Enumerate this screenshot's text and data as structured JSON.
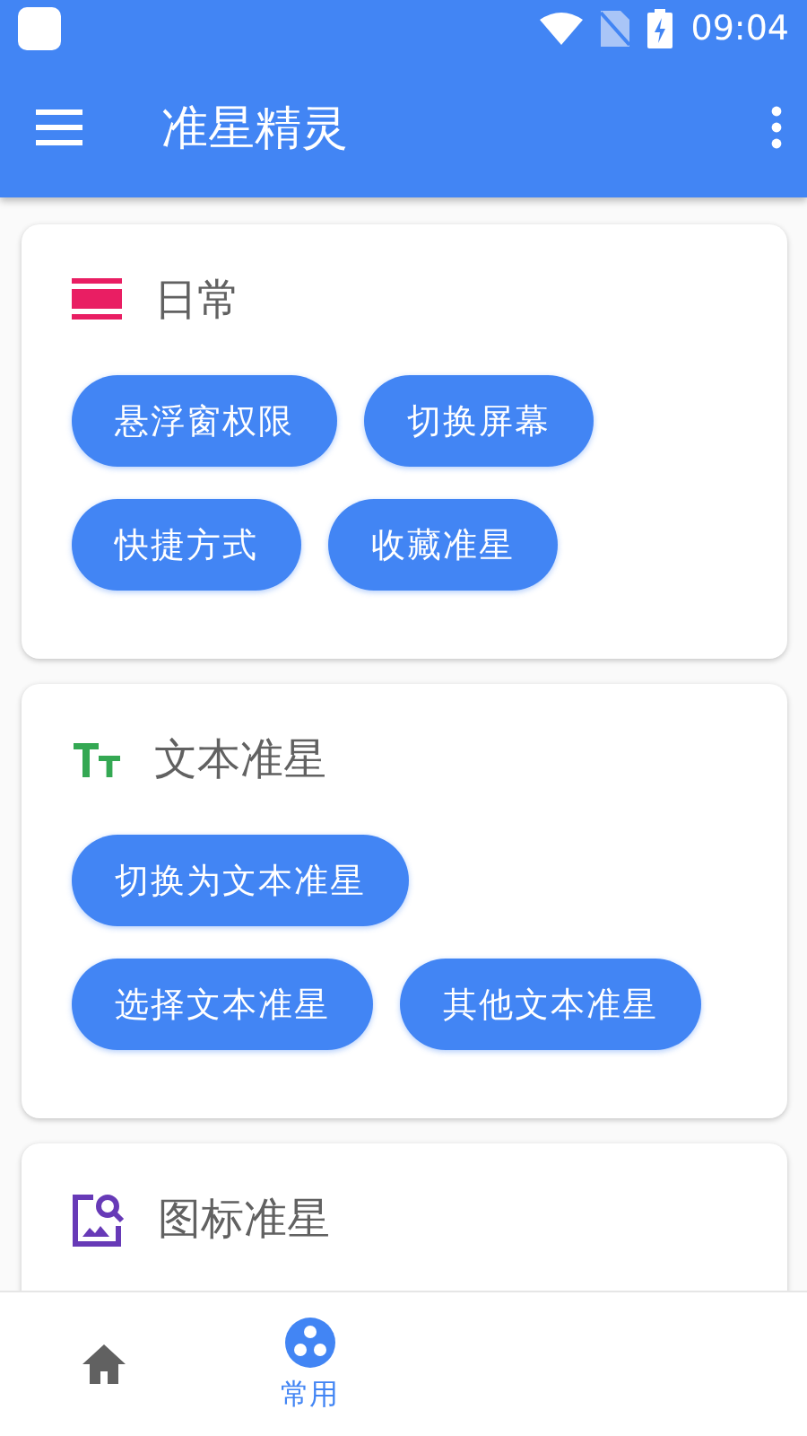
{
  "status_bar": {
    "time": "09:04"
  },
  "app_bar": {
    "title": "准星精灵"
  },
  "cards": [
    {
      "kind": "list",
      "title": "日常",
      "buttons": [
        "悬浮窗权限",
        "切换屏幕",
        "快捷方式",
        "收藏准星"
      ]
    },
    {
      "kind": "text",
      "title": "文本准星",
      "buttons": [
        "切换为文本准星",
        "选择文本准星",
        "其他文本准星"
      ]
    },
    {
      "kind": "image",
      "title": "图标准星"
    }
  ],
  "bottom_nav": [
    {
      "kind": "home",
      "selected": false
    },
    {
      "kind": "group",
      "label": "常用",
      "selected": true
    }
  ]
}
